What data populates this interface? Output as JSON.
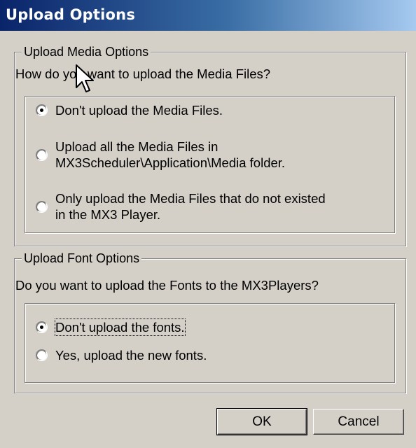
{
  "window": {
    "title": "Upload Options"
  },
  "media": {
    "group_label": "Upload Media Options",
    "question": "How do you want to upload the Media Files?",
    "options": [
      {
        "line1": "Don't upload the Media Files.",
        "line2": "",
        "selected": true
      },
      {
        "line1": "Upload all the Media Files in",
        "line2": "MX3Scheduler\\Application\\Media folder.",
        "selected": false
      },
      {
        "line1": "Only upload the Media Files that do not existed",
        "line2": "in the MX3 Player.",
        "selected": false
      }
    ]
  },
  "fonts": {
    "group_label": "Upload Font Options",
    "question": "Do you want to upload the Fonts to the MX3Players?",
    "options": [
      {
        "line1": "Don't upload the fonts.",
        "selected": true
      },
      {
        "line1": "Yes, upload the new fonts.",
        "selected": false
      }
    ]
  },
  "buttons": {
    "ok": "OK",
    "cancel": "Cancel"
  },
  "icons": {
    "cursor": "mouse-pointer-icon"
  }
}
